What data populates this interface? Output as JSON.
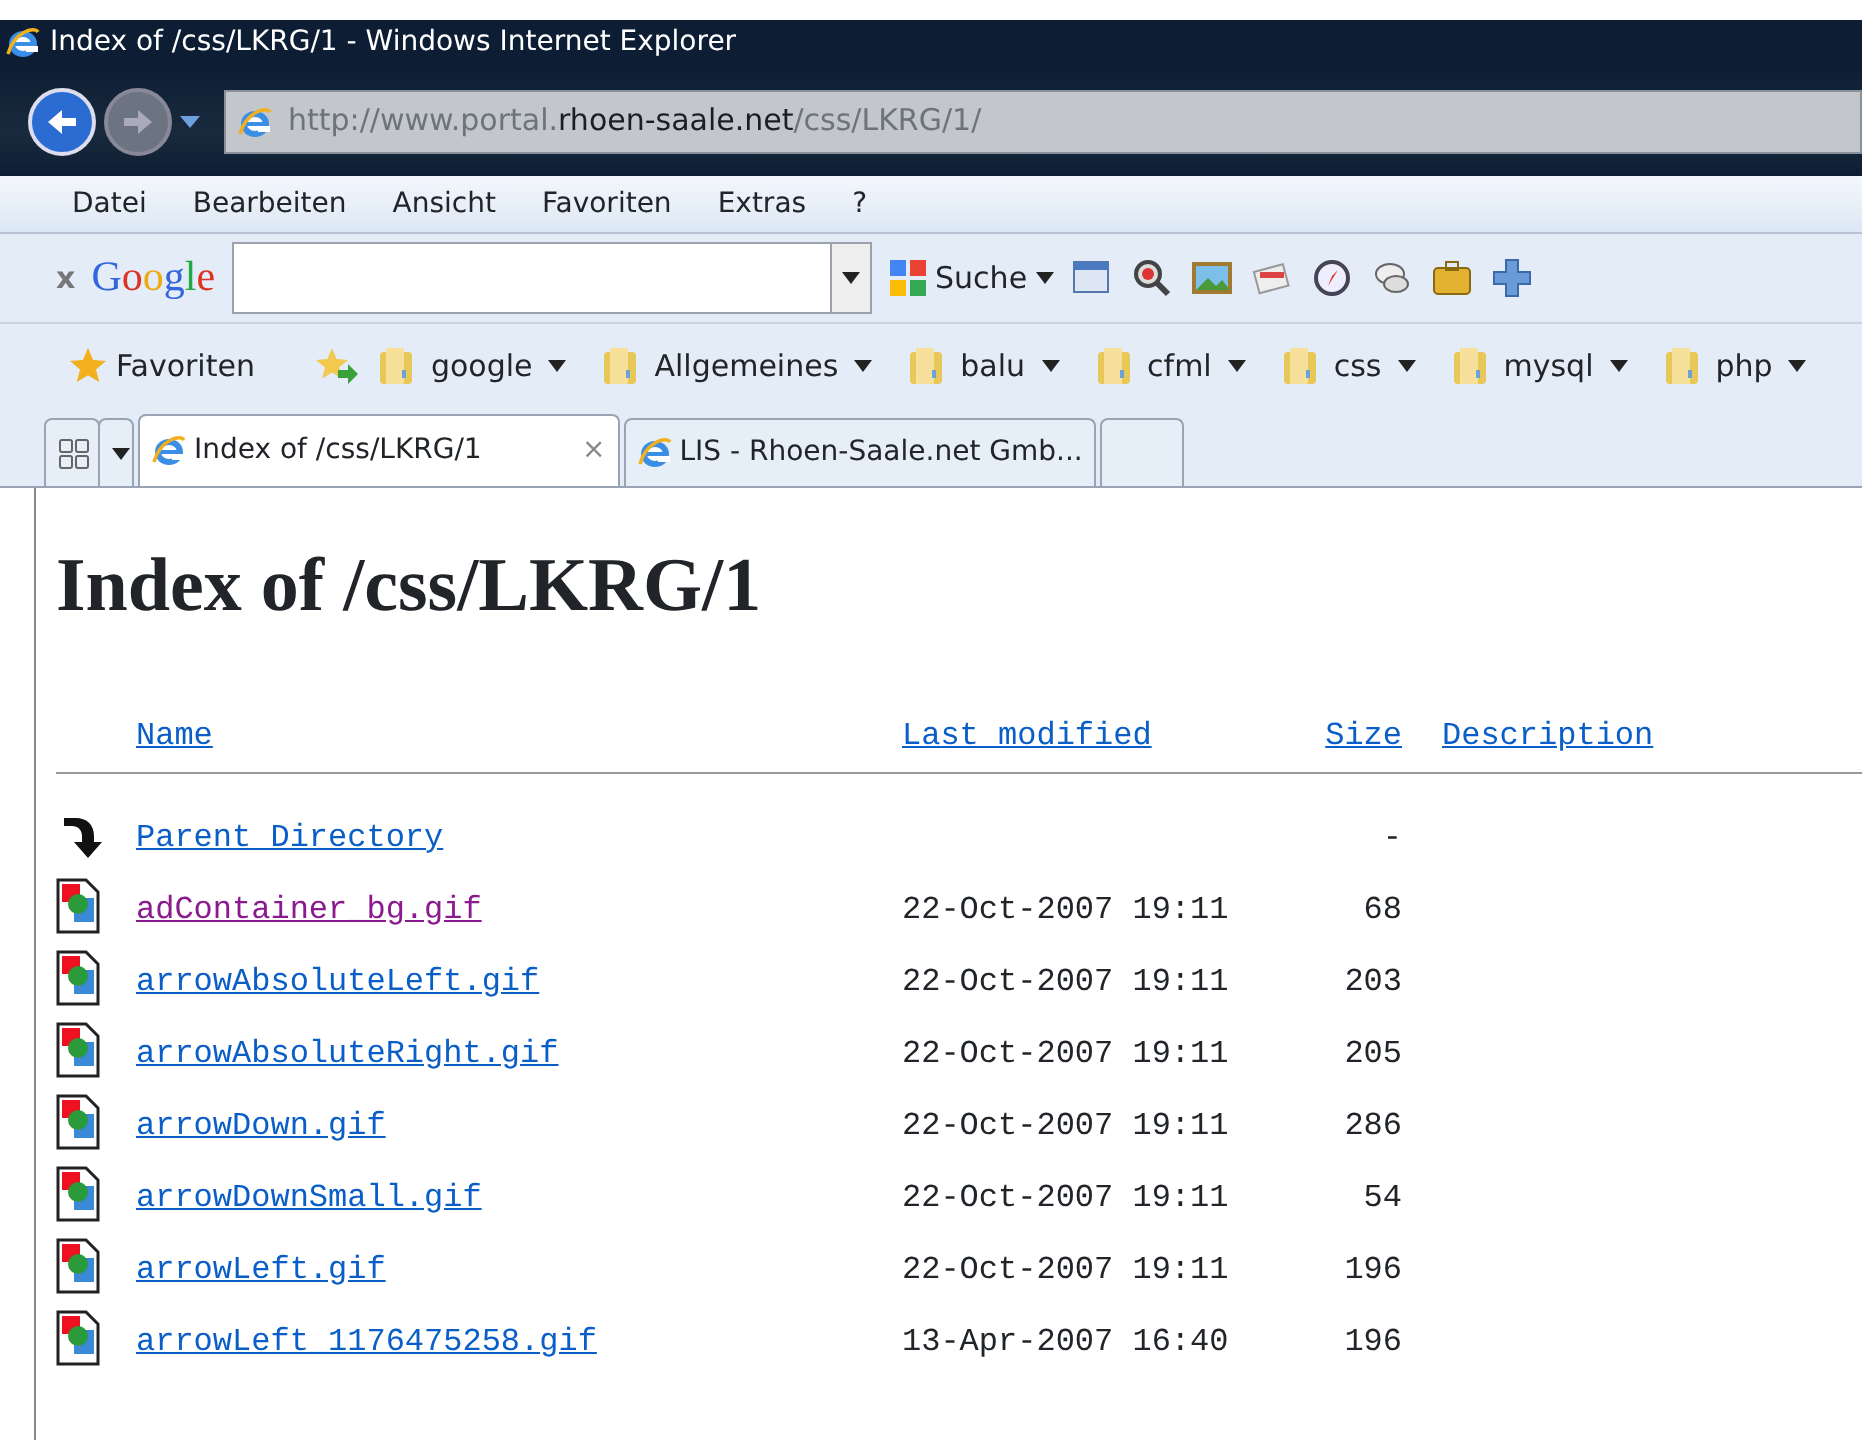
{
  "window": {
    "title": "Index of /css/LKRG/1 - Windows Internet Explorer"
  },
  "address_bar": {
    "url_prefix": "http://www.portal.",
    "url_domain": "rhoen-saale.net",
    "url_suffix": "/css/LKRG/1/"
  },
  "menu": [
    "Datei",
    "Bearbeiten",
    "Ansicht",
    "Favoriten",
    "Extras",
    "?"
  ],
  "google_toolbar": {
    "close": "x",
    "logo": "Google",
    "search_button": "Suche"
  },
  "favorites_bar": {
    "favorites": "Favoriten",
    "folders": [
      "google",
      "Allgemeines",
      "balu",
      "cfml",
      "css",
      "mysql",
      "php"
    ]
  },
  "tabs": [
    {
      "kind": "page",
      "label": "Index of /css/LKRG/1",
      "selected": true,
      "close": "×"
    },
    {
      "kind": "page",
      "label": "LIS - Rhoen-Saale.net Gmb...",
      "selected": false
    },
    {
      "kind": "new",
      "selected": false
    }
  ],
  "page": {
    "heading": "Index of /css/LKRG/1",
    "columns": [
      "Name",
      "Last modified",
      "Size",
      "Description"
    ],
    "rows": [
      {
        "kind": "parent",
        "name": "Parent Directory",
        "size": "-",
        "visited": false
      },
      {
        "kind": "file",
        "name": "adContainer_bg.gif",
        "modified": "22-Oct-2007 19:11",
        "size": "68",
        "visited": true
      },
      {
        "kind": "file",
        "name": "arrowAbsoluteLeft.gif",
        "modified": "22-Oct-2007 19:11",
        "size": "203",
        "visited": false
      },
      {
        "kind": "file",
        "name": "arrowAbsoluteRight.gif",
        "modified": "22-Oct-2007 19:11",
        "size": "205",
        "visited": false
      },
      {
        "kind": "file",
        "name": "arrowDown.gif",
        "modified": "22-Oct-2007 19:11",
        "size": "286",
        "visited": false
      },
      {
        "kind": "file",
        "name": "arrowDownSmall.gif",
        "modified": "22-Oct-2007 19:11",
        "size": "54",
        "visited": false
      },
      {
        "kind": "file",
        "name": "arrowLeft.gif",
        "modified": "22-Oct-2007 19:11",
        "size": "196",
        "visited": false
      },
      {
        "kind": "file",
        "name": "arrowLeft_1176475258.gif",
        "modified": "13-Apr-2007 16:40",
        "size": "196",
        "visited": false
      }
    ]
  }
}
